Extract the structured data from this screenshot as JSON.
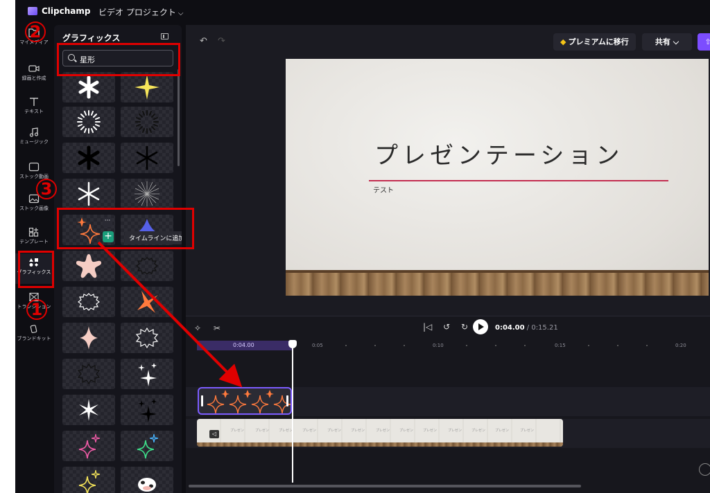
{
  "topbar": {
    "app_name": "Clipchamp",
    "project_title": "ビデオ プロジェクト"
  },
  "leftnav": {
    "items": [
      {
        "label": "マイメディア",
        "icon": "folder-icon"
      },
      {
        "label": "録画と作成",
        "icon": "camera-icon"
      },
      {
        "label": "テキスト",
        "icon": "text-icon"
      },
      {
        "label": "ミュージック",
        "icon": "music-icon"
      },
      {
        "label": "ストック動画",
        "icon": "film-icon"
      },
      {
        "label": "ストック画像",
        "icon": "image-icon"
      },
      {
        "label": "テンプレート",
        "icon": "template-icon"
      },
      {
        "label": "グラフィックス",
        "icon": "shapes-icon"
      },
      {
        "label": "トランジション",
        "icon": "transition-icon"
      },
      {
        "label": "ブランドキット",
        "icon": "brand-icon"
      }
    ]
  },
  "panel": {
    "title": "グラフィックス",
    "search_value": "星形",
    "tooltip": "タイムラインに追加",
    "more": "···"
  },
  "toolbar": {
    "premium_label": "プレミアムに移行",
    "share_label": "共有"
  },
  "slide": {
    "title": "プレゼンテーション",
    "subtitle": "テスト"
  },
  "timeline": {
    "current_time": "0:04.00",
    "total_time": "/ 0:15.21",
    "ruler_selection": "0:04.00",
    "ticks": [
      "0:05",
      "0:10",
      "0:15",
      "0:20"
    ]
  },
  "annotations": {
    "step1": "1",
    "step2": "2",
    "step3": "3"
  },
  "colors": {
    "accent": "#7c4dff",
    "annotation": "#e00000",
    "add_button": "#1a9e7b",
    "underline": "#c32c4f"
  }
}
